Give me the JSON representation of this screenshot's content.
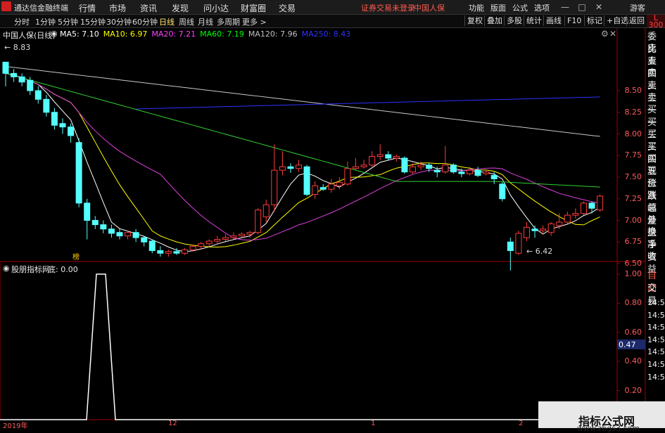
{
  "app": {
    "title": "通达信金融终端"
  },
  "menu": [
    "行情",
    "市场",
    "资讯",
    "发现",
    "问小达",
    "财富圈",
    "交易"
  ],
  "warning": "证券交易未登录",
  "stock": "中国人保",
  "right_menu": [
    "功能",
    "版面",
    "公式",
    "选项"
  ],
  "guest": "游客",
  "window_buttons": [
    "—",
    "□",
    "✕"
  ],
  "periods": [
    "分时",
    "1分钟",
    "5分钟",
    "15分钟",
    "30分钟",
    "60分钟",
    "日线",
    "周线",
    "月线",
    "多周期",
    "更多 >"
  ],
  "active_period": "日线",
  "toolbar_buttons": [
    "复权",
    "叠加",
    "多股",
    "统计",
    "画线",
    "F10",
    "标记",
    "+自选",
    "返回"
  ],
  "corner_badge": "L\n300",
  "main_panel": {
    "title": "中国人保(日线)",
    "ma_labels": [
      {
        "text": "MA5: 7.10",
        "color": "#ffffff"
      },
      {
        "text": "MA10: 6.97",
        "color": "#ffff00"
      },
      {
        "text": "MA20: 7.21",
        "color": "#ff40ff"
      },
      {
        "text": "MA60: 7.19",
        "color": "#00ff00"
      },
      {
        "text": "MA120: 7.96",
        "color": "#c0c0c0"
      },
      {
        "text": "MA250: 8.43",
        "color": "#3030ff"
      }
    ],
    "high_label": "8.83",
    "low_label": "6.42",
    "marker": "榜",
    "y_ticks": [
      "8.50",
      "8.25",
      "8.00",
      "7.75",
      "7.50",
      "7.25",
      "7.00",
      "6.75",
      "6.50"
    ]
  },
  "indicator_panel": {
    "title": "股朋指标网",
    "value_label": "底: 0.00",
    "y_ticks": [
      "1.00",
      "0.80",
      "0.60",
      "0.40",
      "0.20",
      "0.00"
    ]
  },
  "x_labels": [
    "2019年",
    "12",
    "1",
    "2"
  ],
  "right_panel": {
    "quote_items": [
      "委比",
      "卖五",
      "卖四",
      "卖三",
      "卖二",
      "卖一",
      "买一",
      "买二",
      "买三",
      "买四",
      "买五",
      "现价",
      "涨跌",
      "涨幅",
      "总量",
      "外盘",
      "换手",
      "净资",
      "收益"
    ],
    "tabs": [
      "自动",
      "交易"
    ],
    "ticks": [
      "14:56",
      "14:56",
      "14:56",
      "14:56",
      "14:56",
      "14:56",
      "14:56"
    ],
    "highlight": "0.47"
  },
  "watermark": {
    "line1": "指标公式网",
    "line2": "www.zbgs3.com"
  },
  "chart_data": {
    "type": "candlestick",
    "title": "中国人保(日线)",
    "ylim": [
      6.35,
      9.0
    ],
    "yticks": [
      8.5,
      8.25,
      8.0,
      7.75,
      7.5,
      7.25,
      7.0,
      6.75,
      6.5
    ],
    "candles": [
      [
        8.83,
        8.7,
        8.83,
        8.55
      ],
      [
        8.7,
        8.66,
        8.75,
        8.6
      ],
      [
        8.66,
        8.6,
        8.7,
        8.55
      ],
      [
        8.62,
        8.5,
        8.66,
        8.45
      ],
      [
        8.5,
        8.4,
        8.55,
        8.35
      ],
      [
        8.4,
        8.25,
        8.45,
        8.2
      ],
      [
        8.25,
        8.1,
        8.3,
        8.05
      ],
      [
        8.12,
        8.08,
        8.18,
        8.0
      ],
      [
        8.08,
        7.98,
        8.12,
        7.9
      ],
      [
        7.9,
        7.2,
        7.95,
        7.15
      ],
      [
        7.2,
        7.0,
        7.25,
        6.78
      ],
      [
        7.0,
        6.95,
        7.05,
        6.9
      ],
      [
        6.95,
        6.9,
        7.0,
        6.85
      ],
      [
        6.9,
        6.85,
        6.95,
        6.8
      ],
      [
        6.86,
        6.82,
        6.9,
        6.78
      ],
      [
        6.82,
        6.86,
        6.88,
        6.78
      ],
      [
        6.86,
        6.8,
        6.9,
        6.75
      ],
      [
        6.8,
        6.75,
        6.82,
        6.7
      ],
      [
        6.76,
        6.65,
        6.78,
        6.62
      ],
      [
        6.65,
        6.62,
        6.7,
        6.58
      ],
      [
        6.62,
        6.64,
        6.66,
        6.58
      ],
      [
        6.64,
        6.62,
        6.68,
        6.6
      ],
      [
        6.62,
        6.66,
        6.68,
        6.6
      ],
      [
        6.66,
        6.7,
        6.72,
        6.64
      ],
      [
        6.7,
        6.73,
        6.75,
        6.66
      ],
      [
        6.73,
        6.76,
        6.78,
        6.7
      ],
      [
        6.76,
        6.78,
        6.82,
        6.72
      ],
      [
        6.78,
        6.8,
        6.84,
        6.76
      ],
      [
        6.8,
        6.82,
        6.86,
        6.78
      ],
      [
        6.82,
        6.84,
        6.86,
        6.8
      ],
      [
        6.84,
        6.86,
        6.88,
        6.8
      ],
      [
        6.86,
        7.12,
        7.14,
        6.84
      ],
      [
        7.04,
        7.18,
        7.24,
        6.98
      ],
      [
        7.18,
        7.58,
        7.88,
        7.1
      ],
      [
        7.58,
        7.62,
        7.8,
        7.52
      ],
      [
        7.62,
        7.6,
        7.66,
        7.55
      ],
      [
        7.6,
        7.64,
        7.7,
        7.56
      ],
      [
        7.62,
        7.3,
        7.64,
        7.28
      ],
      [
        7.3,
        7.4,
        7.45,
        7.25
      ],
      [
        7.38,
        7.36,
        7.42,
        7.34
      ],
      [
        7.36,
        7.42,
        7.48,
        7.32
      ],
      [
        7.4,
        7.44,
        7.5,
        7.36
      ],
      [
        7.42,
        7.6,
        7.68,
        7.4
      ],
      [
        7.6,
        7.62,
        7.72,
        7.58
      ],
      [
        7.62,
        7.64,
        7.7,
        7.6
      ],
      [
        7.64,
        7.74,
        7.8,
        7.62
      ],
      [
        7.74,
        7.76,
        7.88,
        7.7
      ],
      [
        7.76,
        7.72,
        7.8,
        7.7
      ],
      [
        7.72,
        7.74,
        7.76,
        7.68
      ],
      [
        7.72,
        7.56,
        7.74,
        7.54
      ],
      [
        7.56,
        7.62,
        7.66,
        7.54
      ],
      [
        7.62,
        7.64,
        7.68,
        7.58
      ],
      [
        7.64,
        7.6,
        7.66,
        7.56
      ],
      [
        7.58,
        7.56,
        7.62,
        7.5
      ],
      [
        7.56,
        7.64,
        7.86,
        7.54
      ],
      [
        7.64,
        7.56,
        7.66,
        7.54
      ],
      [
        7.56,
        7.54,
        7.6,
        7.5
      ],
      [
        7.54,
        7.58,
        7.62,
        7.52
      ],
      [
        7.58,
        7.52,
        7.62,
        7.5
      ],
      [
        7.54,
        7.56,
        7.58,
        7.52
      ],
      [
        7.52,
        7.48,
        7.56,
        7.42
      ],
      [
        7.42,
        7.25,
        7.44,
        7.22
      ],
      [
        6.75,
        6.65,
        6.8,
        6.42
      ],
      [
        6.62,
        6.85,
        6.88,
        6.6
      ],
      [
        6.8,
        6.92,
        6.98,
        6.76
      ],
      [
        6.9,
        6.88,
        6.94,
        6.8
      ],
      [
        6.88,
        6.9,
        6.94,
        6.84
      ],
      [
        6.86,
        6.96,
        6.98,
        6.82
      ],
      [
        6.94,
        6.98,
        7.08,
        6.9
      ],
      [
        6.98,
        7.06,
        7.1,
        6.96
      ],
      [
        7.06,
        7.08,
        7.14,
        7.02
      ],
      [
        7.08,
        7.2,
        7.22,
        7.06
      ],
      [
        7.2,
        7.14,
        7.22,
        7.08
      ],
      [
        7.12,
        7.28,
        7.3,
        7.1
      ]
    ]
  }
}
